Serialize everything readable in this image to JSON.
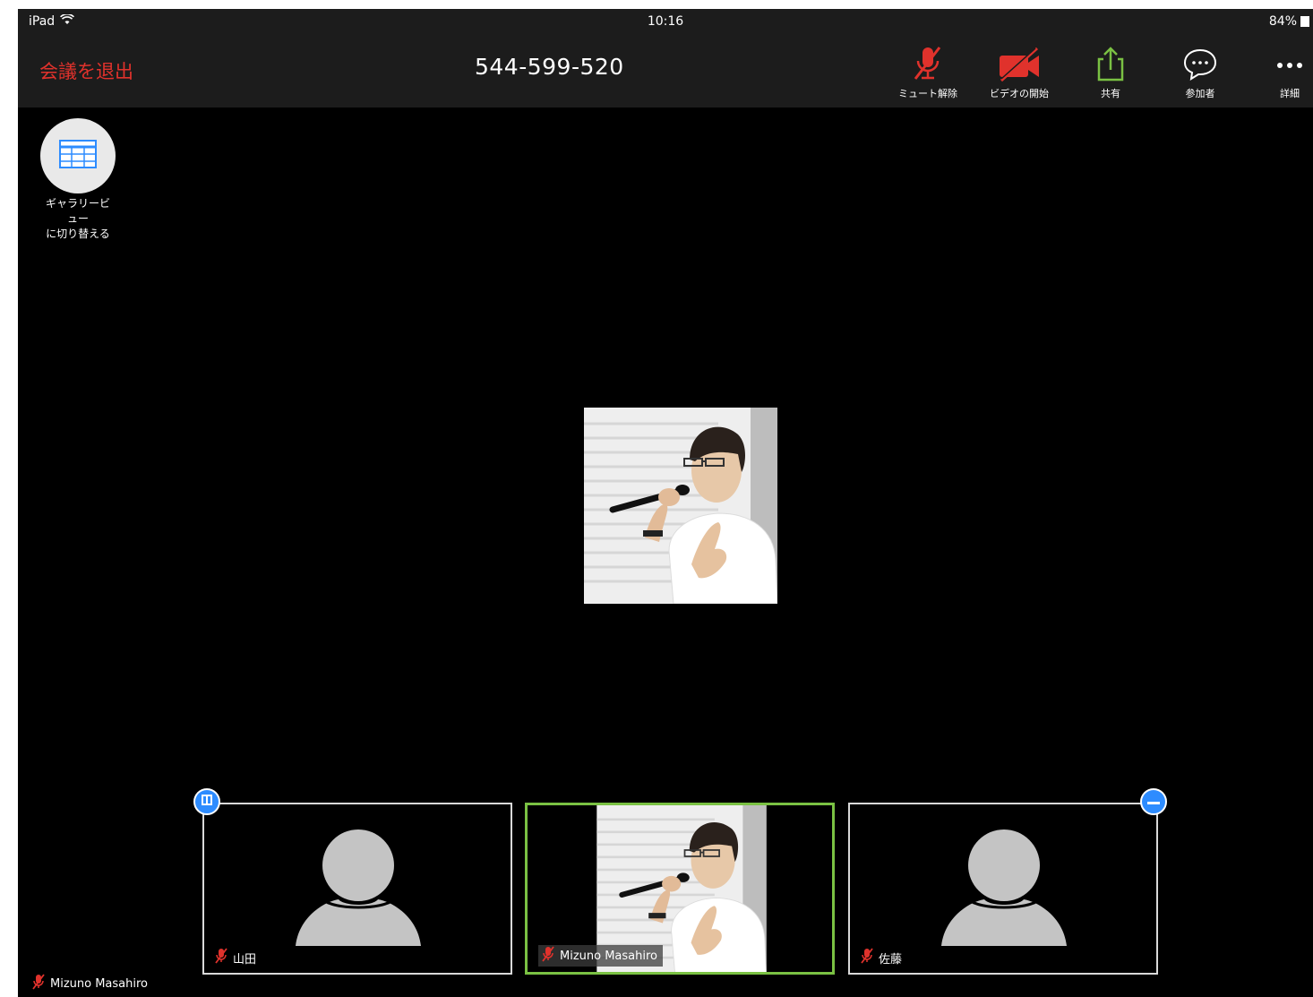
{
  "status_bar": {
    "device": "iPad",
    "time": "10:16",
    "battery": "84%"
  },
  "toolbar": {
    "leave_label": "会議を退出",
    "meeting_id": "544-599-520",
    "tools": {
      "mute": "ミュート解除",
      "video": "ビデオの開始",
      "share": "共有",
      "participants": "参加者",
      "more": "詳細"
    }
  },
  "gallery_toggle": {
    "line1": "ギャラリービ",
    "line2": "ュー",
    "line3": "に切り替える"
  },
  "thumbnails": [
    {
      "name": "山田",
      "muted": true,
      "video": false
    },
    {
      "name": "Mizuno Masahiro",
      "muted": true,
      "video": true,
      "active": true
    },
    {
      "name": "佐藤",
      "muted": true,
      "video": false
    }
  ],
  "self_label": "Mizuno Masahiro",
  "colors": {
    "leave": "#e0322c",
    "share": "#7ac143",
    "active_border": "#7ac143",
    "badge": "#2d8cff",
    "muted": "#e0322c"
  }
}
